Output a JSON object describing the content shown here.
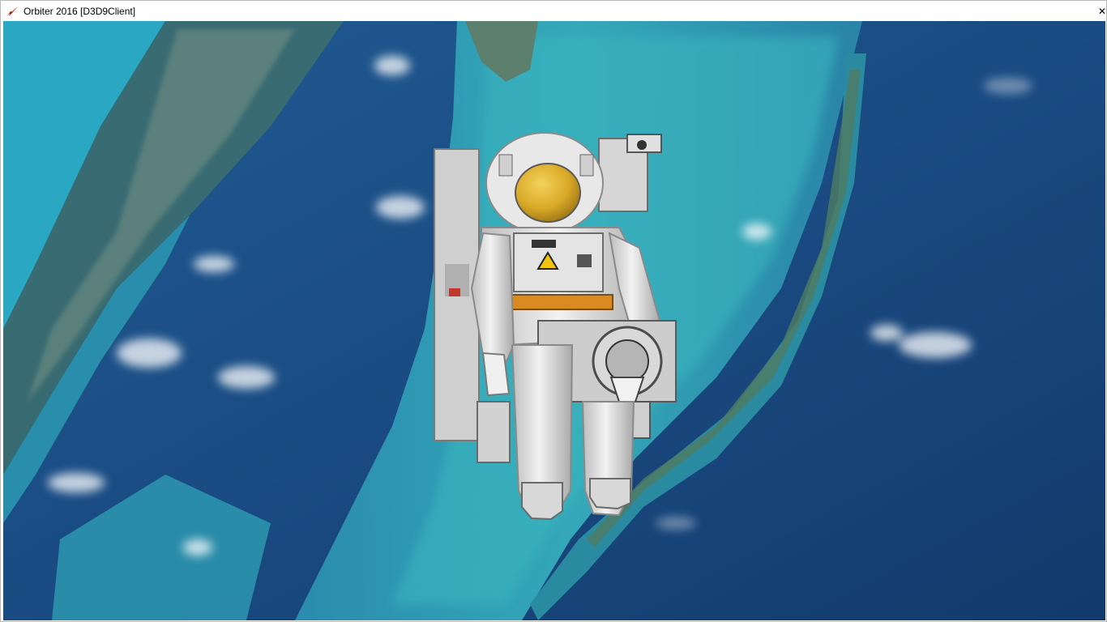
{
  "window": {
    "title": "Orbiter 2016 [D3D9Client]",
    "icon": "orbiter-app-icon",
    "close_label": "✕"
  },
  "scene": {
    "subject": "astronaut-eva",
    "visor_color": "#e0b32e",
    "suit_color": "#e6e6e6",
    "ocean_deep": "#173f75",
    "ocean_shallow": "#2fa5b4"
  }
}
